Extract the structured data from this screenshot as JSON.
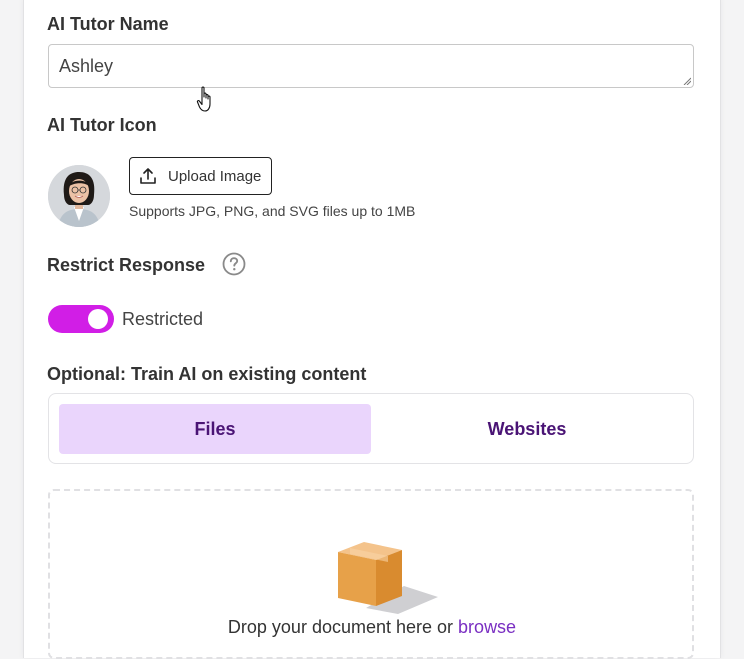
{
  "name_section": {
    "label": "AI Tutor Name",
    "value": "Ashley"
  },
  "icon_section": {
    "label": "AI Tutor Icon",
    "upload_label": "Upload Image",
    "hint": "Supports JPG, PNG, and SVG files up to 1MB"
  },
  "restrict_section": {
    "label": "Restrict Response",
    "toggle_state": "on",
    "toggle_label": "Restricted"
  },
  "train_section": {
    "label": "Optional: Train AI on existing content",
    "tabs": [
      {
        "label": "Files",
        "active": true
      },
      {
        "label": "Websites",
        "active": false
      }
    ],
    "drop_text": "Drop your document here or",
    "browse_label": "browse"
  },
  "colors": {
    "accent_toggle": "#d11ee6",
    "active_tab_bg": "#ead5fc",
    "tab_text": "#4a1475",
    "link": "#7a2fc2"
  }
}
